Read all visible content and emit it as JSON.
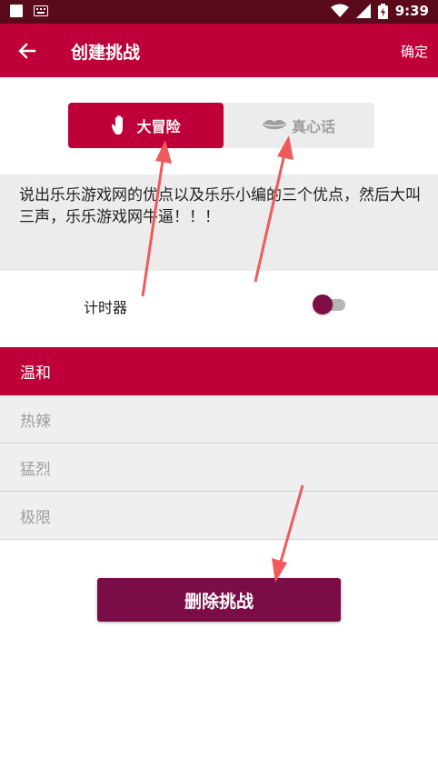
{
  "status_bar": {
    "time": "9:39"
  },
  "app_bar": {
    "title": "创建挑战",
    "confirm_label": "确定"
  },
  "mode_tabs": [
    {
      "label": "大冒险",
      "icon": "hand-icon",
      "selected": true
    },
    {
      "label": "真心话",
      "icon": "lips-icon",
      "selected": false
    }
  ],
  "challenge": {
    "text": "说出乐乐游戏网的优点以及乐乐小编的三个优点，然后大叫三声，乐乐游戏网牛逼！！！"
  },
  "timer": {
    "label": "计时器",
    "enabled": false
  },
  "levels": [
    {
      "label": "温和",
      "selected": true
    },
    {
      "label": "热辣",
      "selected": false
    },
    {
      "label": "猛烈",
      "selected": false
    },
    {
      "label": "极限",
      "selected": false
    }
  ],
  "delete_button": {
    "label": "删除挑战"
  },
  "colors": {
    "primary": "#bf0038",
    "status_bar": "#5b0a1c",
    "delete_button": "#7b0d46",
    "annotation_arrow": "#f05a5a"
  }
}
